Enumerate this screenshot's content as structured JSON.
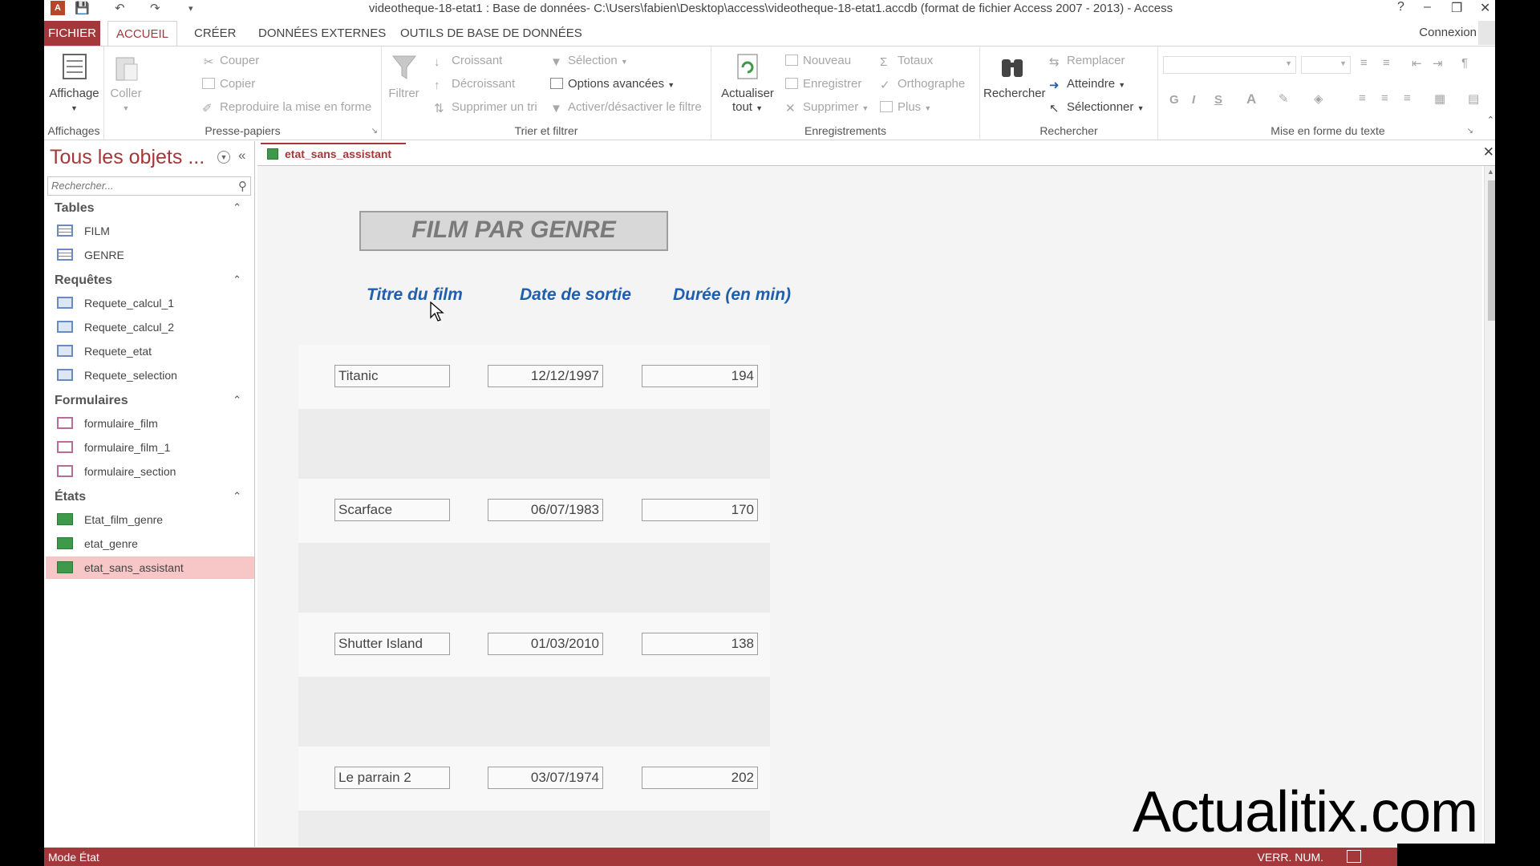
{
  "window": {
    "title": "videotheque-18-etat1 : Base de données- C:\\Users\\fabien\\Desktop\\access\\videotheque-18-etat1.accdb (format de fichier Access 2007 - 2013) - Access",
    "app_icon": "A",
    "help": "?"
  },
  "tabs": {
    "file": "FICHIER",
    "home": "ACCUEIL",
    "create": "CRÉER",
    "external": "DONNÉES EXTERNES",
    "dbtools": "OUTILS DE BASE DE DONNÉES",
    "signin": "Connexion"
  },
  "ribbon": {
    "views": {
      "button": "Affichage",
      "group": "Affichages"
    },
    "clipboard": {
      "paste": "Coller",
      "cut": "Couper",
      "copy": "Copier",
      "format_painter": "Reproduire la mise en forme",
      "group": "Presse-papiers"
    },
    "sort": {
      "filter": "Filtrer",
      "asc": "Croissant",
      "desc": "Décroissant",
      "remove_sort": "Supprimer un tri",
      "selection": "Sélection",
      "advanced": "Options avancées",
      "toggle_filter": "Activer/désactiver le filtre",
      "group": "Trier et filtrer"
    },
    "records": {
      "refresh": "Actualiser",
      "refresh2": "tout",
      "new": "Nouveau",
      "save": "Enregistrer",
      "delete": "Supprimer",
      "totals": "Totaux",
      "spelling": "Orthographe",
      "more": "Plus",
      "group": "Enregistrements"
    },
    "find": {
      "find": "Rechercher",
      "replace": "Remplacer",
      "goto": "Atteindre",
      "select": "Sélectionner",
      "group": "Rechercher"
    },
    "text": {
      "bold": "G",
      "italic": "I",
      "underline": "S",
      "font_color": "A",
      "group": "Mise en forme du texte"
    }
  },
  "nav": {
    "title": "Tous les objets ...",
    "search_placeholder": "Rechercher...",
    "sections": [
      {
        "heading": "Tables",
        "items": [
          {
            "label": "FILM",
            "type": "table"
          },
          {
            "label": "GENRE",
            "type": "table"
          }
        ]
      },
      {
        "heading": "Requêtes",
        "items": [
          {
            "label": "Requete_calcul_1",
            "type": "query"
          },
          {
            "label": "Requete_calcul_2",
            "type": "query"
          },
          {
            "label": "Requete_etat",
            "type": "query"
          },
          {
            "label": "Requete_selection",
            "type": "query"
          }
        ]
      },
      {
        "heading": "Formulaires",
        "items": [
          {
            "label": "formulaire_film",
            "type": "form"
          },
          {
            "label": "formulaire_film_1",
            "type": "form"
          },
          {
            "label": "formulaire_section",
            "type": "form"
          }
        ]
      },
      {
        "heading": "États",
        "items": [
          {
            "label": "Etat_film_genre",
            "type": "report"
          },
          {
            "label": "etat_genre",
            "type": "report"
          },
          {
            "label": "etat_sans_assistant",
            "type": "report",
            "selected": true
          }
        ]
      }
    ]
  },
  "document": {
    "tab": "etat_sans_assistant",
    "report_title": "FILM PAR GENRE",
    "columns": [
      "Titre du film",
      "Date de sortie",
      "Durée (en min)"
    ],
    "rows": [
      {
        "title": "Titanic",
        "date": "12/12/1997",
        "duration": "194"
      },
      {
        "title": "Scarface",
        "date": "06/07/1983",
        "duration": "170"
      },
      {
        "title": "Shutter Island",
        "date": "01/03/2010",
        "duration": "138"
      },
      {
        "title": "Le parrain 2",
        "date": "03/07/1974",
        "duration": "202"
      }
    ]
  },
  "status": {
    "mode": "Mode État",
    "numlock": "VERR. NUM."
  },
  "watermark": "Actualitix.com",
  "colors": {
    "accent": "#a4373a",
    "header_text": "#1f5fad",
    "selected_item": "#f7c6c7"
  }
}
